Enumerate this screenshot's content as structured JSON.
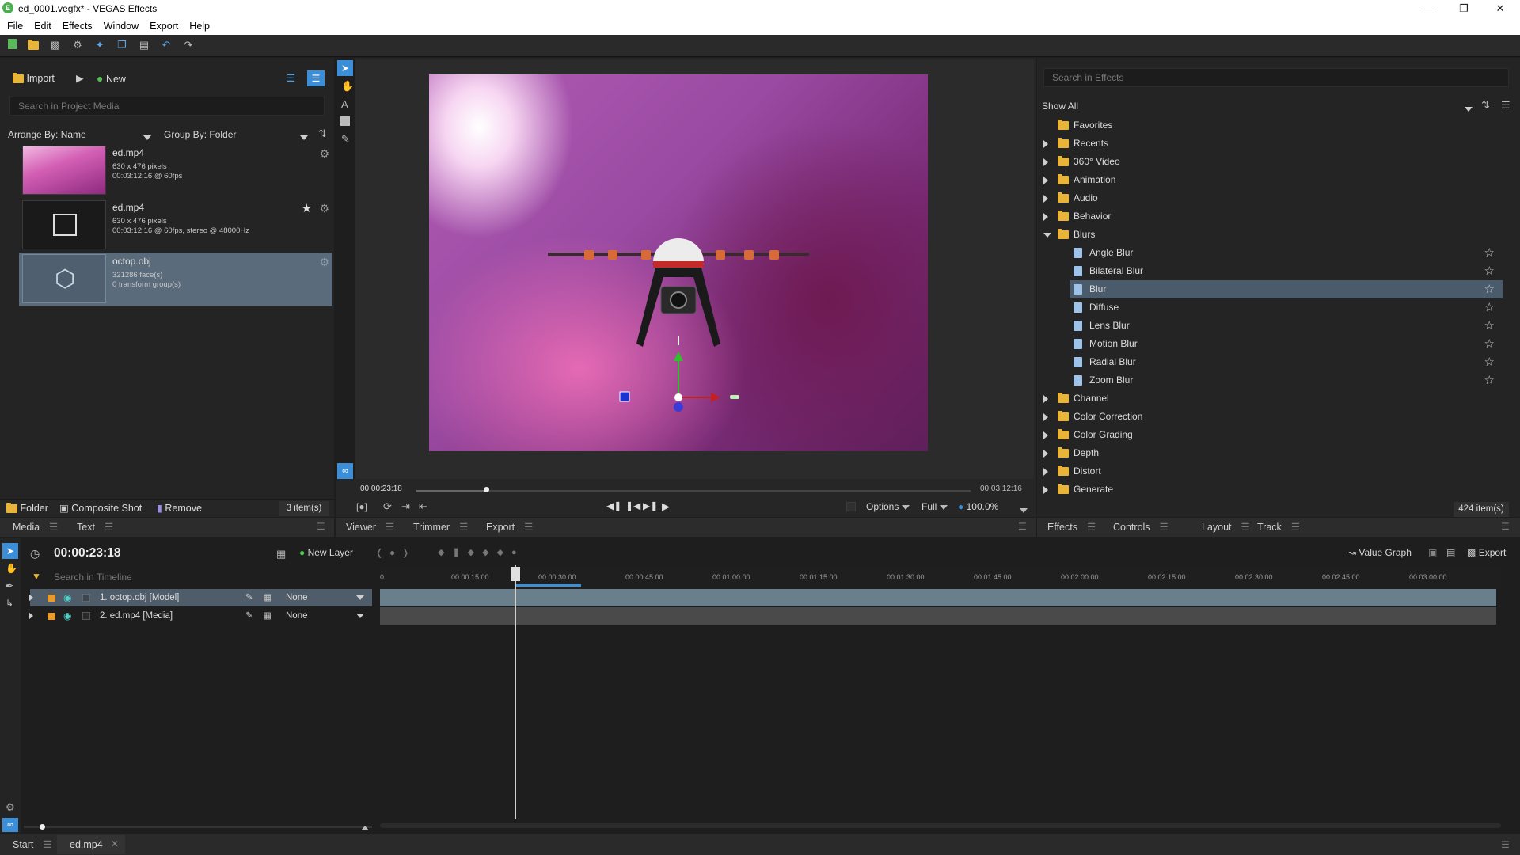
{
  "window": {
    "title": "ed_0001.vegfx* - VEGAS Effects",
    "app_icon": "vegas-effects-logo",
    "controls": [
      "minimize-icon",
      "restore-icon",
      "close-icon"
    ]
  },
  "menu": [
    "File",
    "Edit",
    "Effects",
    "Window",
    "Export",
    "Help"
  ],
  "toolbar": {
    "icons": [
      "new-project-icon",
      "open-folder-icon",
      "save-icon",
      "settings-icon",
      "magic-wand-icon",
      "copy-icon",
      "paste-icon",
      "undo-icon",
      "redo-icon"
    ]
  },
  "media": {
    "import_label": "Import",
    "new_label": "New",
    "search_placeholder": "Search in Project Media",
    "arrange_label": "Arrange By: Name",
    "group_label": "Group By: Folder",
    "items": [
      {
        "name": "ed.mp4",
        "line1": "630 x 476 pixels",
        "line2": "00:03:12:16 @ 60fps"
      },
      {
        "name": "ed.mp4",
        "line1": "630 x 476 pixels",
        "line2": "00:03:12:16 @ 60fps, stereo @ 48000Hz"
      },
      {
        "name": "octop.obj",
        "line1": "321286 face(s)",
        "line2": "0 transform group(s)"
      }
    ],
    "footer": {
      "folder": "Folder",
      "composite": "Composite Shot",
      "remove": "Remove",
      "count": "3 item(s)"
    },
    "tabs": [
      "Media",
      "Text"
    ]
  },
  "viewer": {
    "current_time": "00:00:23:18",
    "end_time": "00:03:12:16",
    "scrub_progress": 0.125,
    "options_label": "Options",
    "quality_label": "Full",
    "zoom_label": "100.0%",
    "tabs": [
      "Viewer",
      "Trimmer",
      "Export"
    ],
    "tools": [
      "select-arrow-icon",
      "hand-icon",
      "text-tool-icon",
      "rectangle-tool-icon",
      "pen-tool-icon"
    ]
  },
  "effects": {
    "search_placeholder": "Search in Effects",
    "filter_label": "Show All",
    "tree": [
      {
        "label": "Favorites",
        "type": "folder",
        "expander": "none",
        "star": false
      },
      {
        "label": "Recents",
        "type": "folder",
        "expander": "collapsed",
        "star": false
      },
      {
        "label": "360° Video",
        "type": "folder",
        "expander": "collapsed",
        "star": false
      },
      {
        "label": "Animation",
        "type": "folder",
        "expander": "collapsed",
        "star": false
      },
      {
        "label": "Audio",
        "type": "folder",
        "expander": "collapsed",
        "star": false
      },
      {
        "label": "Behavior",
        "type": "folder",
        "expander": "collapsed",
        "star": false
      },
      {
        "label": "Blurs",
        "type": "folder",
        "expander": "expanded",
        "star": false
      },
      {
        "label": "Angle Blur",
        "type": "effect",
        "expander": "none",
        "star": true
      },
      {
        "label": "Bilateral Blur",
        "type": "effect",
        "expander": "none",
        "star": true
      },
      {
        "label": "Blur",
        "type": "effect",
        "expander": "none",
        "star": true,
        "selected": true
      },
      {
        "label": "Diffuse",
        "type": "effect",
        "expander": "none",
        "star": true
      },
      {
        "label": "Lens Blur",
        "type": "effect",
        "expander": "none",
        "star": true
      },
      {
        "label": "Motion Blur",
        "type": "effect",
        "expander": "none",
        "star": true
      },
      {
        "label": "Radial Blur",
        "type": "effect",
        "expander": "none",
        "star": true
      },
      {
        "label": "Zoom Blur",
        "type": "effect",
        "expander": "none",
        "star": true
      },
      {
        "label": "Channel",
        "type": "folder",
        "expander": "collapsed",
        "star": false
      },
      {
        "label": "Color Correction",
        "type": "folder",
        "expander": "collapsed",
        "star": false
      },
      {
        "label": "Color Grading",
        "type": "folder",
        "expander": "collapsed",
        "star": false
      },
      {
        "label": "Depth",
        "type": "folder",
        "expander": "collapsed",
        "star": false
      },
      {
        "label": "Distort",
        "type": "folder",
        "expander": "collapsed",
        "star": false
      },
      {
        "label": "Generate",
        "type": "folder",
        "expander": "collapsed",
        "star": false
      }
    ],
    "count": "424 item(s)",
    "tabs": [
      "Effects",
      "Controls",
      "Layout",
      "Track"
    ]
  },
  "timeline": {
    "time": "00:00:23:18",
    "new_layer_label": "New Layer",
    "search_placeholder": "Search in Timeline",
    "value_graph_label": "Value Graph",
    "export_label": "Export",
    "ruler_ticks": [
      "0",
      "00:00:15:00",
      "00:00:30:00",
      "00:00:45:00",
      "00:01:00:00",
      "00:01:15:00",
      "00:01:30:00",
      "00:01:45:00",
      "00:02:00:00",
      "00:02:15:00",
      "00:02:30:00",
      "00:02:45:00",
      "00:03:00:00"
    ],
    "layers": [
      {
        "label": "1. octop.obj [Model]",
        "blend": "None",
        "selected": true
      },
      {
        "label": "2. ed.mp4 [Media]",
        "blend": "None",
        "selected": false
      }
    ]
  },
  "status": {
    "tabs": [
      {
        "label": "Start"
      },
      {
        "label": "ed.mp4"
      }
    ]
  },
  "colors": {
    "accent": "#3c8fd6",
    "folder": "#e8b43a",
    "selection": "#4a5b6b",
    "playhead": "#d0d0d0"
  }
}
